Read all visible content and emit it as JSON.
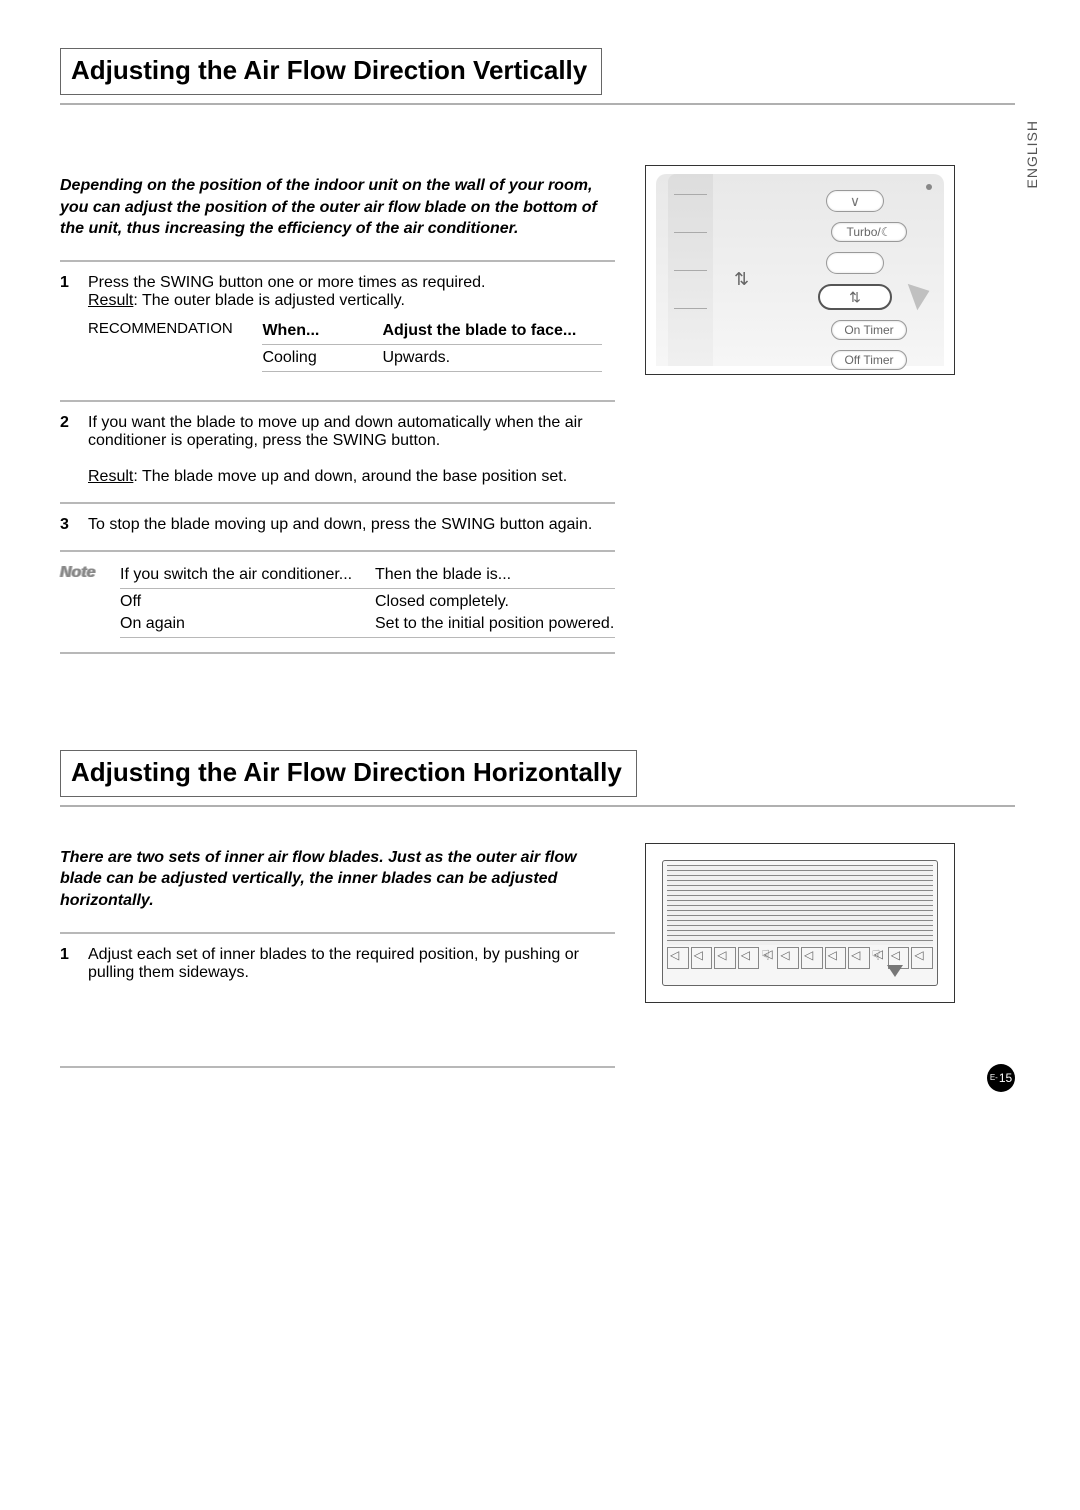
{
  "lang_tab": "ENGLISH",
  "page_number_prefix": "E-",
  "page_number": "15",
  "section1": {
    "title": "Adjusting the Air Flow Direction Vertically",
    "intro": "Depending on the position of the indoor unit on the wall of your room, you can adjust the position of the outer air flow blade on the bottom of the unit, thus increasing the efficiency of the air conditioner.",
    "step1": {
      "num": "1",
      "text": "Press the SWING button one or more times as required.",
      "result_label": "Result",
      "result_text": ":   The outer blade is adjusted vertically."
    },
    "recommendation": {
      "label": "RECOMMENDATION",
      "hdr_when": "When...",
      "hdr_adjust": "Adjust the blade to face...",
      "row_when": "Cooling",
      "row_adjust": "Upwards."
    },
    "step2": {
      "num": "2",
      "text": "If you want the blade to move up and down automatically when the air conditioner is operating, press the SWING button.",
      "result_label": "Result",
      "result_text": ":   The blade move up and down, around the base position set."
    },
    "step3": {
      "num": "3",
      "text": "To stop the blade moving up and down, press the SWING button again."
    },
    "note": {
      "label": "Note",
      "hdr_if": "If you switch the air conditioner...",
      "hdr_then": "Then the blade is...",
      "r1c1": "Off",
      "r1c2": "Closed completely.",
      "r2c1": "On again",
      "r2c2": "Set to the initial position powered."
    },
    "remote": {
      "down_symbol": "∨",
      "turbo": "Turbo/☾",
      "swing_center": "⇅",
      "swing": "⇅",
      "on_timer": "On Timer",
      "off_timer": "Off Timer"
    }
  },
  "section2": {
    "title": "Adjusting the Air Flow Direction Horizontally",
    "intro": "There are two sets of inner air flow blades. Just as the outer air flow blade can be adjusted vertically, the inner blades can be adjusted horizontally.",
    "step1": {
      "num": "1",
      "text": "Adjust each set of inner blades to the required position, by pushing or pulling them sideways."
    }
  }
}
